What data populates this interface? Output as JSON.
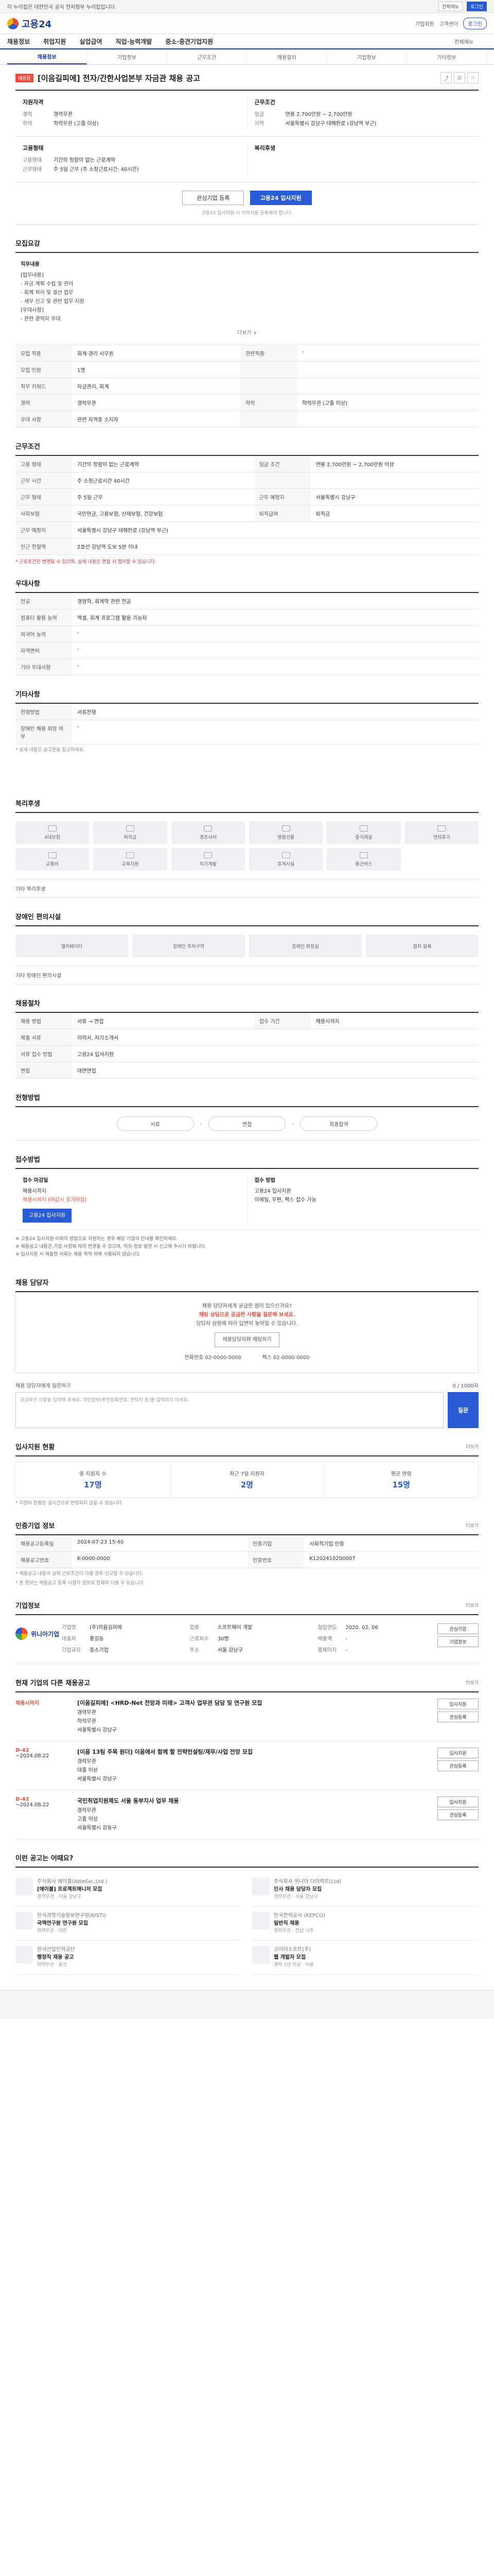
{
  "topbar": {
    "notice": "이 누리집은 대한민국 공식 전자정부 누리집입니다.",
    "btn1": "전체메뉴",
    "btn2": "로그인"
  },
  "header": {
    "logo": "고용24",
    "links": [
      "기업회원",
      "고객센터"
    ],
    "login": "로그인"
  },
  "gnb": [
    "채용정보",
    "취업지원",
    "실업급여",
    "직업·능력개발",
    "중소·중견기업지원"
  ],
  "gnb_all": "전체메뉴",
  "tabs": [
    "채용정보",
    "기업정보",
    "근무조건",
    "채용절차",
    "기업정보",
    "기타정보"
  ],
  "posting": {
    "flag": "채용중",
    "title": "[이음길피에] 전자/간한사업본부 자금관 채용 공고",
    "summary_left_title": "지원자격",
    "summary_left": [
      {
        "k": "경력",
        "v": "경력무관"
      },
      {
        "k": "학력",
        "v": "학력무관 (고졸 이상)"
      }
    ],
    "summary_right_title": "근무조건",
    "summary_right": [
      {
        "k": "임금",
        "v": "연봉 2,700만원 ~ 2,700만원"
      },
      {
        "k": "지역",
        "v": "서울특별시 강남구 테헤란로 (강남역 부근)"
      }
    ],
    "summary2_left_title": "고용형태",
    "summary2_left": [
      {
        "k": "고용형태",
        "v": "기간의 정함이 없는 근로계약"
      },
      {
        "k": "근무형태",
        "v": "주 5일 근무 (주 소정근로시간: 40시간)"
      }
    ],
    "summary2_right_title": "복리후생",
    "apply_btn1": "관심기업 등록",
    "apply_btn2": "고용24 입사지원",
    "apply_note": "고용24 입사지원 시 이력서를 등록해야 합니다."
  },
  "sec_job": {
    "title": "모집요강",
    "more": "",
    "job_head": "직무내용",
    "job_lines": [
      "[업무내용]",
      "- 자금 계획 수립 및 관리",
      "- 회계 처리 및 결산 업무",
      "- 세무 신고 및 관련 업무 지원",
      "[우대사항]",
      "- 관련 경력자 우대"
    ],
    "job_more": "더보기 ∨",
    "rows": [
      {
        "k": "모집 직종",
        "v": "회계·경리 사무원",
        "k2": "관련직종",
        "v2": "-"
      },
      {
        "k": "모집 인원",
        "v": "1명",
        "k2": "",
        "v2": ""
      },
      {
        "k": "직무 키워드",
        "v": "자금관리, 회계",
        "k2": "",
        "v2": ""
      },
      {
        "k": "경력",
        "v": "경력무관",
        "k2": "학력",
        "v2": "학력무관 (고졸 이상)"
      },
      {
        "k": "우대 사항",
        "v": "관련 자격증 소지자",
        "k2": "",
        "v2": ""
      }
    ]
  },
  "sec_cond": {
    "title": "근무조건",
    "rows": [
      {
        "k": "고용 형태",
        "v": "기간의 정함이 없는 근로계약",
        "k2": "임금 조건",
        "v2": "연봉 2,700만원 ~ 2,700만원 이상"
      },
      {
        "k": "근무 시간",
        "v": "주 소정근로시간 40시간",
        "k2": "",
        "v2": ""
      },
      {
        "k": "근무 형태",
        "v": "주 5일 근무",
        "k2": "근무 예정지",
        "v2": "서울특별시 강남구"
      },
      {
        "k": "사회보험",
        "v": "국민연금, 고용보험, 산재보험, 건강보험",
        "k2": "퇴직급여",
        "v2": "퇴직금"
      },
      {
        "k": "근무 예정지",
        "v": "서울특별시 강남구 테헤란로 (강남역 부근)",
        "k2": "",
        "v2": ""
      },
      {
        "k": "인근 전철역",
        "v": "2호선 강남역 도보 5분 이내",
        "k2": "",
        "v2": ""
      }
    ],
    "note": "* 근로조건은 변경될 수 있으며, 상세 내용은 면접 시 협의할 수 있습니다."
  },
  "sec_etc": {
    "title": "우대사항",
    "rows": [
      {
        "k": "전공",
        "v": "경영학, 회계학 관련 전공"
      },
      {
        "k": "컴퓨터 활용 능력",
        "v": "엑셀, 회계 프로그램 활용 가능자"
      },
      {
        "k": "외국어 능력",
        "v": "-"
      },
      {
        "k": "자격면허",
        "v": "-"
      },
      {
        "k": "기타 우대사항",
        "v": "-"
      }
    ]
  },
  "sec_apply_cond": {
    "title": "기타사항",
    "rows": [
      {
        "k": "전형방법",
        "v": "서류전형"
      },
      {
        "k": "장애인 채용 희망 여부",
        "v": "-"
      }
    ],
    "note": "* 상세 내용은 공고문을 참고하세요."
  },
  "sec_welfare": {
    "title": "복리후생",
    "items": [
      "4대보험",
      "퇴직금",
      "경조사비",
      "명절선물",
      "중식제공",
      "연차휴가",
      "교통비",
      "교육지원",
      "자기계발",
      "휴게시설",
      "통근버스"
    ],
    "etc": "기타 복리후생"
  },
  "sec_facility": {
    "title": "장애인 편의시설",
    "items": [
      "엘리베이터",
      "장애인 주차구역",
      "장애인 화장실",
      "점자 블록"
    ],
    "etc": "기타 장애인 편의시설"
  },
  "sec_recruit": {
    "title": "채용절차",
    "rows": [
      {
        "k": "채용 방법",
        "v": "서류 → 면접",
        "k2": "접수 기간",
        "v2": "채용시까지"
      },
      {
        "k": "제출 서류",
        "v": "이력서, 자기소개서",
        "k2": "",
        "v2": ""
      },
      {
        "k": "서류 접수 방법",
        "v": "고용24 입사지원",
        "k2": "",
        "v2": ""
      },
      {
        "k": "면접",
        "v": "대면면접",
        "k2": "",
        "v2": ""
      }
    ]
  },
  "sec_process": {
    "title": "전형방법",
    "steps": [
      "서류",
      "면접",
      "최종합격"
    ]
  },
  "sec_howto": {
    "title": "접수방법",
    "left_h": "접수 마감일",
    "left_v": "채용시까지",
    "left_red": "채용시까지 (마감시 조기마감)",
    "left_btn": "고용24 입사지원",
    "right_h": "접수 방법",
    "right_v": "고용24 입사지원",
    "right_v2": "이메일, 우편, 팩스 접수 가능",
    "bullets": [
      "※ 고용24 입사지원 이외의 방법으로 지원하는 경우 해당 기업의 안내를 확인하세요.",
      "※ 채용공고 내용은 기업 사정에 따라 변경될 수 있으며, 허위 정보 발견 시 신고해 주시기 바랍니다.",
      "※ 입사지원 시 제출한 서류는 채용 목적 외에 사용되지 않습니다."
    ]
  },
  "sec_contact": {
    "title": "채용 담당자",
    "chat_text1": "채용 담당자에게 궁금한 점이 있으신가요?",
    "chat_red": "채팅 상담으로 궁금한 사항을 질문해 보세요.",
    "chat_text2": "담당자 상황에 따라 답변이 늦어질 수 있습니다.",
    "chat_btn": "채용담당자와 채팅하기",
    "phone": "전화번호 02-0000-0000",
    "fax": "팩스 02-0000-0000",
    "qna_title": "채용 담당자에게 질문하기",
    "qna_count": "0 / 1000자",
    "qna_placeholder": "궁금하신 사항을 입력해 주세요. 개인정보(주민등록번호, 연락처 등)를 입력하지 마세요.",
    "qna_btn": "질문"
  },
  "sec_stats": {
    "title": "입사지원 현황",
    "more": "더보기",
    "stats": [
      {
        "label": "총 지원자 수",
        "value": "17명"
      },
      {
        "label": "최근 7일 지원자",
        "value": "2명"
      },
      {
        "label": "평균 연령",
        "value": "15명"
      }
    ],
    "note": "* 지원자 현황은 실시간으로 반영되지 않을 수 있습니다."
  },
  "sec_manage": {
    "title": "인증기업 정보",
    "more": "더보기",
    "rows": [
      {
        "k": "채용공고등록일",
        "v": "2024-07-23 15:40",
        "k2": "인증기업",
        "v2": "사회적기업 인증"
      },
      {
        "k": "채용공고번호",
        "v": "K-0000-0000",
        "k2": "인증번호",
        "v2": "K1202410200007"
      }
    ],
    "notes": [
      "* 채용공고 내용과 실제 근로조건이 다를 경우 신고할 수 있습니다.",
      "* 본 정보는 채용공고 등록 시점의 정보로 현재와 다를 수 있습니다."
    ]
  },
  "sec_company": {
    "title": "기업정보",
    "more": "더보기",
    "logo": "위니아기업",
    "rows": [
      {
        "k": "기업명",
        "v": "(주)이음길피에"
      },
      {
        "k": "업종",
        "v": "소프트웨어 개발"
      },
      {
        "k": "설립연도",
        "v": "2020. 02. 06"
      },
      {
        "k": "대표자",
        "v": "홍길동"
      },
      {
        "k": "근로자수",
        "v": "30명"
      },
      {
        "k": "매출액",
        "v": "-"
      },
      {
        "k": "기업규모",
        "v": "중소기업"
      },
      {
        "k": "주소",
        "v": "서울 강남구"
      },
      {
        "k": "홈페이지",
        "v": "-"
      }
    ],
    "btns": [
      "관심기업",
      "기업정보"
    ]
  },
  "sec_other": {
    "title": "현재 기업의 다른 채용공고",
    "more": "더보기",
    "items": [
      {
        "date": "채용시까지",
        "dday": "",
        "title": "[이음길피에] <HRD-Net 전망과 미래> 고객사 업무관 담당 및 연구원 모집",
        "lines": [
          "경력무관",
          "학력무관",
          "서울특별시 강남구"
        ],
        "btns": [
          "입사지원",
          "관심등록"
        ]
      },
      {
        "date": "D-42",
        "dday": "~2024.08.22",
        "title": "[이음 13팀 주목 원더] 이음에서 함께 할 전략컨설팅/재무/사업 전망 모집",
        "lines": [
          "경력무관",
          "대졸 이상",
          "서울특별시 강남구"
        ],
        "btns": [
          "입사지원",
          "관심등록"
        ]
      },
      {
        "date": "D-42",
        "dday": "~2024.08.22",
        "title": "국민취업지원제도 서울 동부지사 업무 채용",
        "lines": [
          "경력무관",
          "고졸 이상",
          "서울특별시 강동구"
        ],
        "btns": [
          "입사지원",
          "관심등록"
        ]
      }
    ]
  },
  "sec_recommend": {
    "title": "이런 공고는 어때요?",
    "items": [
      {
        "comp": "주식회사 에이블(AbleGo.,Ltd.)",
        "title": "[에이블] 프로젝트매니저 모집",
        "meta": "경력무관 · 서울 강남구"
      },
      {
        "comp": "주식회사 위니아 다이렉트(Ltd)",
        "title": "인사 채용 담당자 모집",
        "meta": "경력무관 · 서울 강남구"
      },
      {
        "comp": "한국과학기술정보연구원(KISTI)",
        "title": "국책연구원 연구원 모집",
        "meta": "학력무관 · 대전"
      },
      {
        "comp": "한국전력공사 (KEPCO)",
        "title": "일반직 채용",
        "meta": "경력무관 · 전남 나주"
      },
      {
        "comp": "한국산업인력공단",
        "title": "행정직 채용 공고",
        "meta": "학력무관 · 울산"
      },
      {
        "comp": "코리아소프트(주)",
        "title": "웹 개발자 모집",
        "meta": "경력 1년 이상 · 서울"
      }
    ]
  }
}
